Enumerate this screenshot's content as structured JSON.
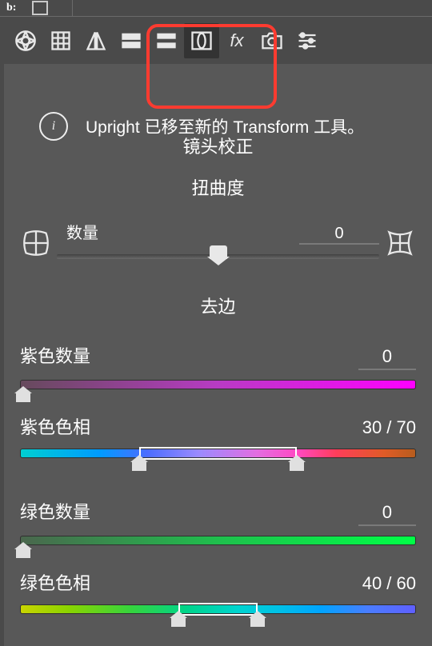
{
  "topbar": {
    "label": "b:"
  },
  "toolbar": {
    "tools": [
      "aperture",
      "grid",
      "split",
      "detail",
      "graduated",
      "lens",
      "fx",
      "camera",
      "sliders"
    ],
    "tooltip": "镜头校正"
  },
  "info": {
    "text": "Upright 已移至新的 Transform 工具。"
  },
  "distortion": {
    "section_title": "扭曲度",
    "amount_label": "数量",
    "amount_value": "0"
  },
  "defringe": {
    "section_title": "去边",
    "purple_amount_label": "紫色数量",
    "purple_amount_value": "0",
    "purple_hue_label": "紫色色相",
    "purple_hue_value": "30 / 70",
    "green_amount_label": "绿色数量",
    "green_amount_value": "0",
    "green_hue_label": "绿色色相",
    "green_hue_value": "40 / 60"
  }
}
